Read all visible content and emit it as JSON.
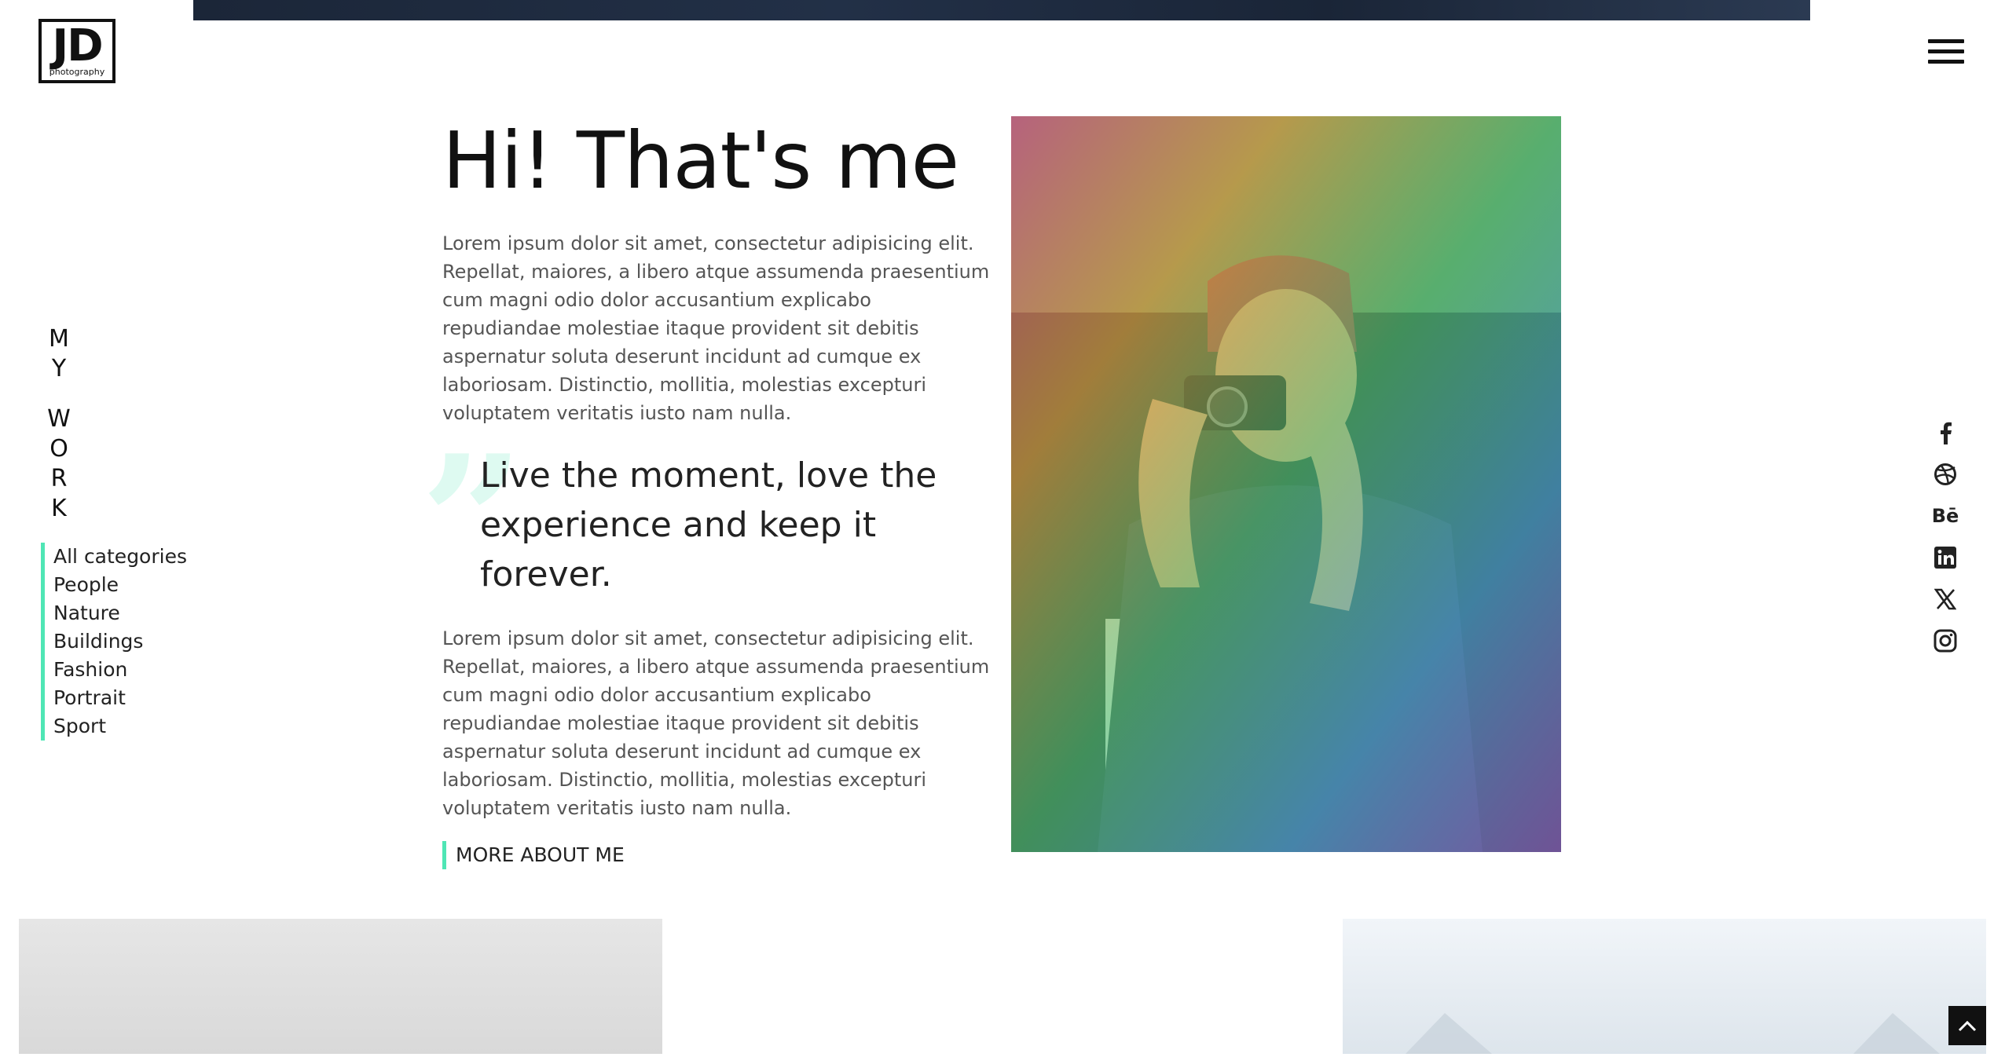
{
  "brand": {
    "monogram": "JD",
    "tagline": "photography"
  },
  "menu": {
    "icon": "hamburger-menu-icon"
  },
  "sidebar": {
    "title_letters": [
      "M",
      "Y",
      "W",
      "O",
      "R",
      "K"
    ],
    "categories": [
      "All categories",
      "People",
      "Nature",
      "Buildings",
      "Fashion",
      "Portrait",
      "Sport"
    ],
    "accent_color": "#4fe6b5"
  },
  "about": {
    "heading": "Hi! That's me",
    "paragraph1": "Lorem ipsum dolor sit amet, consectetur adipisicing elit. Repellat, maiores, a libero atque assumenda praesentium cum magni odio dolor accusantium explicabo repudiandae molestiae itaque provident sit debitis aspernatur soluta deserunt incidunt ad cumque ex laboriosam. Distinctio, mollitia, molestias excepturi voluptatem veritatis iusto nam nulla.",
    "quote": "Live the moment, love the experience and keep it forever.",
    "paragraph2": "Lorem ipsum dolor sit amet, consectetur adipisicing elit. Repellat, maiores, a libero atque assumenda praesentium cum magni odio dolor accusantium explicabo repudiandae molestiae itaque provident sit debitis aspernatur soluta deserunt incidunt ad cumque ex laboriosam. Distinctio, mollitia, molestias excepturi voluptatem veritatis iusto nam nulla.",
    "more_button": "MORE ABOUT ME"
  },
  "social": [
    "facebook-icon",
    "dribbble-icon",
    "behance-icon",
    "linkedin-icon",
    "x-icon",
    "instagram-icon"
  ],
  "behance_text": "Bē"
}
